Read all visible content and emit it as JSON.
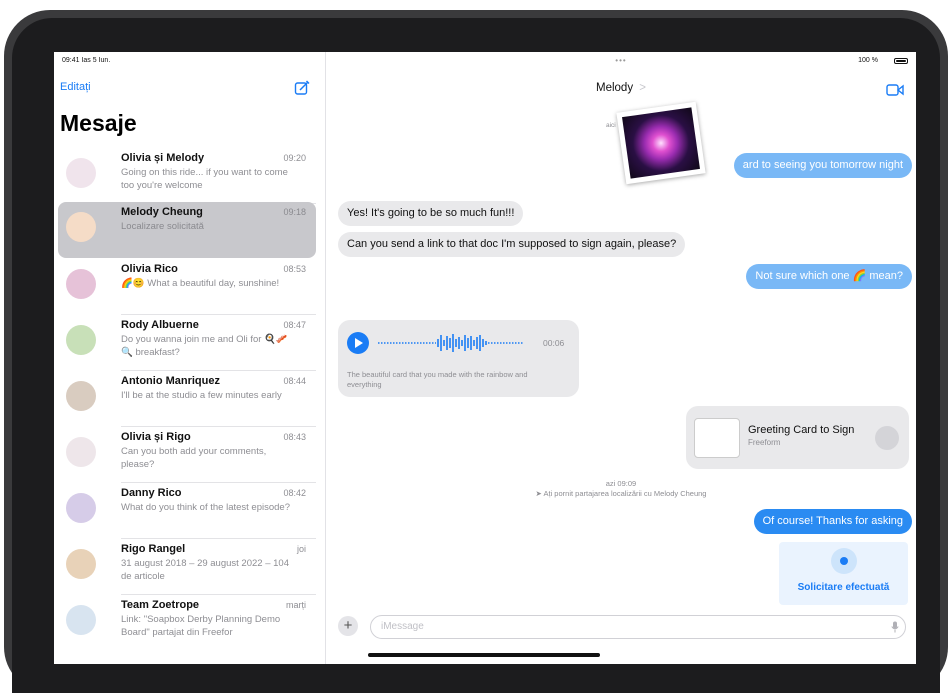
{
  "status": {
    "time": "09:41 Ias 5 Iun.",
    "battery": "100 %",
    "dots": "•••"
  },
  "sidebar": {
    "edit_label": "Editați",
    "title": "Mesaje",
    "conversations": [
      {
        "name": "Olivia și Melody",
        "time": "09:20",
        "preview": "Going on this ride... if you want to come too you're welcome"
      },
      {
        "name": "Melody Cheung",
        "time": "09:18",
        "preview": "Localizare solicitată"
      },
      {
        "name": "Olivia Rico",
        "time": "08:53",
        "preview": "🌈😊 What a beautiful day, sunshine!"
      },
      {
        "name": "Rody Albuerne",
        "time": "08:47",
        "preview": "Do you wanna join me and Oli for 🍳🥓🔍 breakfast?"
      },
      {
        "name": "Antonio Manriquez",
        "time": "08:44",
        "preview": "I'll be at the studio a few minutes early"
      },
      {
        "name": "Olivia și Rigo",
        "time": "08:43",
        "preview": "Can you both add your comments, please?"
      },
      {
        "name": "Danny Rico",
        "time": "08:42",
        "preview": "What do you think of the latest episode?"
      },
      {
        "name": "Rigo Rangel",
        "time": "joi",
        "preview": "31 august 2018 – 29 august 2022 – 104 de articole"
      },
      {
        "name": "Team Zoetrope",
        "time": "marți",
        "preview": "Link: \"Soapbox Derby Planning Demo Board\" partajat din Freefor"
      }
    ]
  },
  "chat": {
    "contact_name": "Melody",
    "chevron": ">",
    "photo_caption": "aici",
    "messages": {
      "out1": "ard to seeing you tomorrow night",
      "in1": "Yes! It's going to be so much fun!!!",
      "in2": "Can you send a link to that doc I'm supposed to sign again, please?",
      "out2": "Not sure which one 🌈 mean?",
      "audio_duration": "00:06",
      "audio_caption": "The beautiful card that you made with the rainbow and everything",
      "card_title": "Greeting Card to Sign",
      "card_subtitle": "Freeform",
      "sys_time": "azi 09:09",
      "sys_text": "➤ Ați pornit partajarea localizării cu Melody Cheung",
      "out3": "Of course! Thanks for asking",
      "loc_request": "Solicitare efectuată"
    },
    "input_placeholder": "iMessage",
    "plus_label": "+"
  },
  "colors": {
    "accent": "#1a7cf5",
    "bubble_out": "#2a8bf2",
    "bubble_in": "#e9e9eb"
  }
}
